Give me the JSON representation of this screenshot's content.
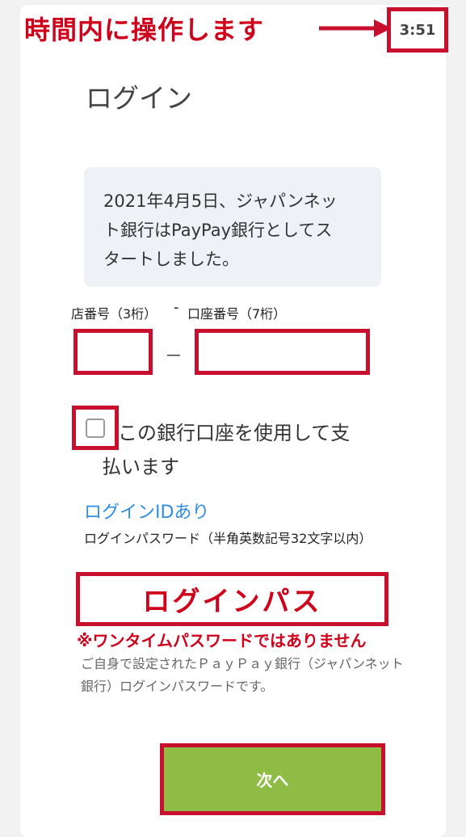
{
  "header": {
    "timer_note": "時間内に操作します",
    "timer": "3:51"
  },
  "page": {
    "title": "ログイン"
  },
  "notice": {
    "line1": "2021年4月5日、ジャパンネッ",
    "line2": "ト銀行はPayPay銀行としてス",
    "line3": "タートしました。"
  },
  "account_fields": {
    "branch_label": "店番号（3桁）",
    "separator": "-",
    "account_label": "口座番号（7桁）",
    "input_dash": "－",
    "branch_value": "",
    "account_value": ""
  },
  "checkbox": {
    "label_line1": "この銀行口座を使用して支",
    "label_line2": "払います",
    "checked": false
  },
  "login": {
    "id_link": "ログインIDあり",
    "password_label": "ログインパスワード（半角英数記号32文字以内）",
    "password_annotation": "ログインパス",
    "otp_note": "※ワンタイムパスワードではありません",
    "help_text": "ご自身で設定されたＰａｙＰａｙ銀行（ジャパンネット銀行）ログインパスワードです。"
  },
  "actions": {
    "next_label": "次へ",
    "next_color": "#8fbc45"
  },
  "colors": {
    "annotation_red": "#c8102e",
    "link_blue": "#2f8de4",
    "notice_bg": "#eef2f6"
  }
}
